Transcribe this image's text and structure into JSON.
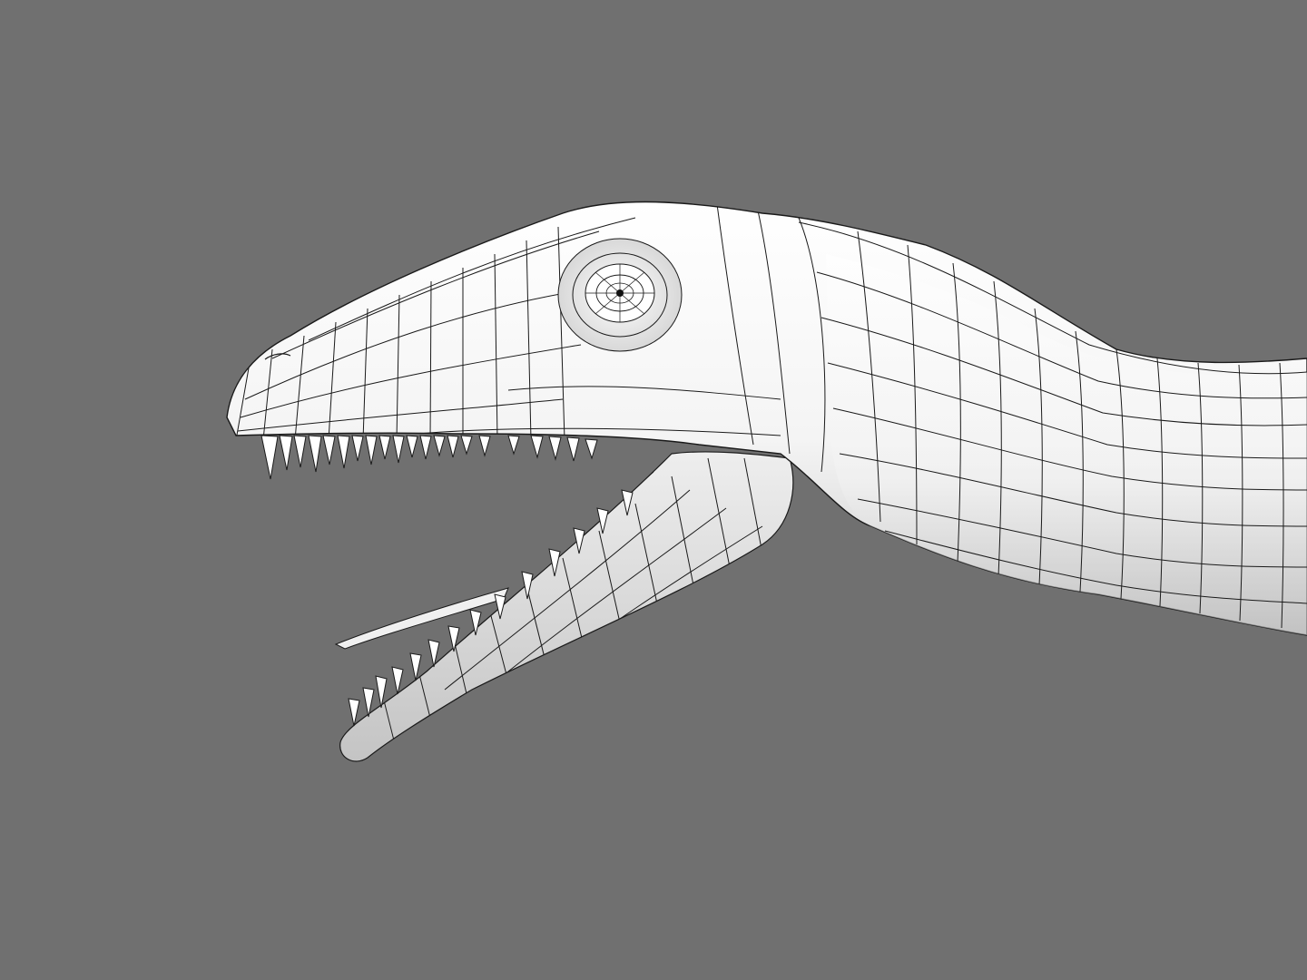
{
  "scene": {
    "background_color": "#707070",
    "subject": "wireframe-dinosaur-head",
    "surface_color": "#ffffff",
    "shade_color": "#c8c8c8",
    "wire_color": "#1a1a1a"
  }
}
